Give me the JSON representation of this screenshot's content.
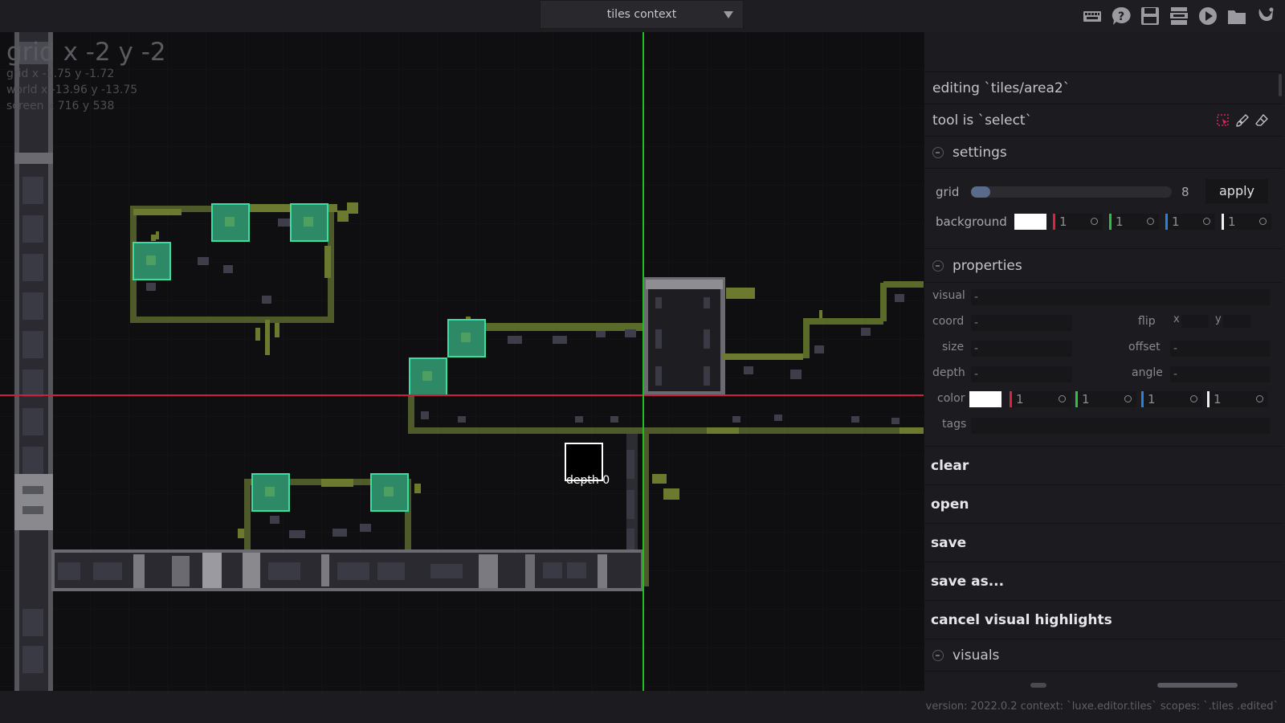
{
  "topbar": {
    "context_label": "tiles context",
    "icons": [
      "keyboard-icon",
      "help-icon",
      "save-icon",
      "layers-icon",
      "play-icon",
      "folder-icon",
      "luxe-logo-icon"
    ]
  },
  "viewport": {
    "title": "grid x -2 y -2",
    "grid_line": "grid x -1.75 y -1.72",
    "world_line": "world x -13.96 y -13.75",
    "screen_line": "screen x 716 y 538",
    "cursor_label": "depth 0"
  },
  "panel": {
    "editing": "editing `tiles/area2`",
    "tool": "tool is `select`",
    "tool_icons": [
      "select-icon",
      "brush-icon",
      "eraser-icon"
    ],
    "settings": {
      "header": "settings",
      "grid_label": "grid",
      "grid_value": "8",
      "grid_fraction": 0.05,
      "apply_label": "apply",
      "background_label": "background",
      "background_channels": [
        "1",
        "1",
        "1",
        "1"
      ]
    },
    "properties": {
      "header": "properties",
      "visual_label": "visual",
      "visual_value": "-",
      "coord_label": "coord",
      "coord_value": "-",
      "flip_label": "flip",
      "flip_x_label": "x",
      "flip_y_label": "y",
      "size_label": "size",
      "size_value": "-",
      "offset_label": "offset",
      "offset_value": "-",
      "depth_label": "depth",
      "depth_value": "-",
      "angle_label": "angle",
      "angle_value": "-",
      "color_label": "color",
      "color_channels": [
        "1",
        "1",
        "1",
        "1"
      ],
      "tags_label": "tags",
      "tags_value": ""
    },
    "actions": {
      "clear": "clear",
      "open": "open",
      "save": "save",
      "save_as": "save as...",
      "cancel_highlights": "cancel visual highlights"
    },
    "visuals_header": "visuals"
  },
  "status": {
    "text": "version: 2022.0.2 context: `luxe.editor.tiles` scopes: `.tiles .edited`"
  },
  "colors": {
    "accent_red": "#e0205a",
    "channel_red": "#e02040",
    "channel_green": "#30c040",
    "channel_blue": "#2a80e0",
    "channel_white": "#f0f0f0",
    "axis_red": "#d01e3c",
    "axis_green": "#1fbf1f",
    "highlight_teal": "#3ddca0"
  }
}
